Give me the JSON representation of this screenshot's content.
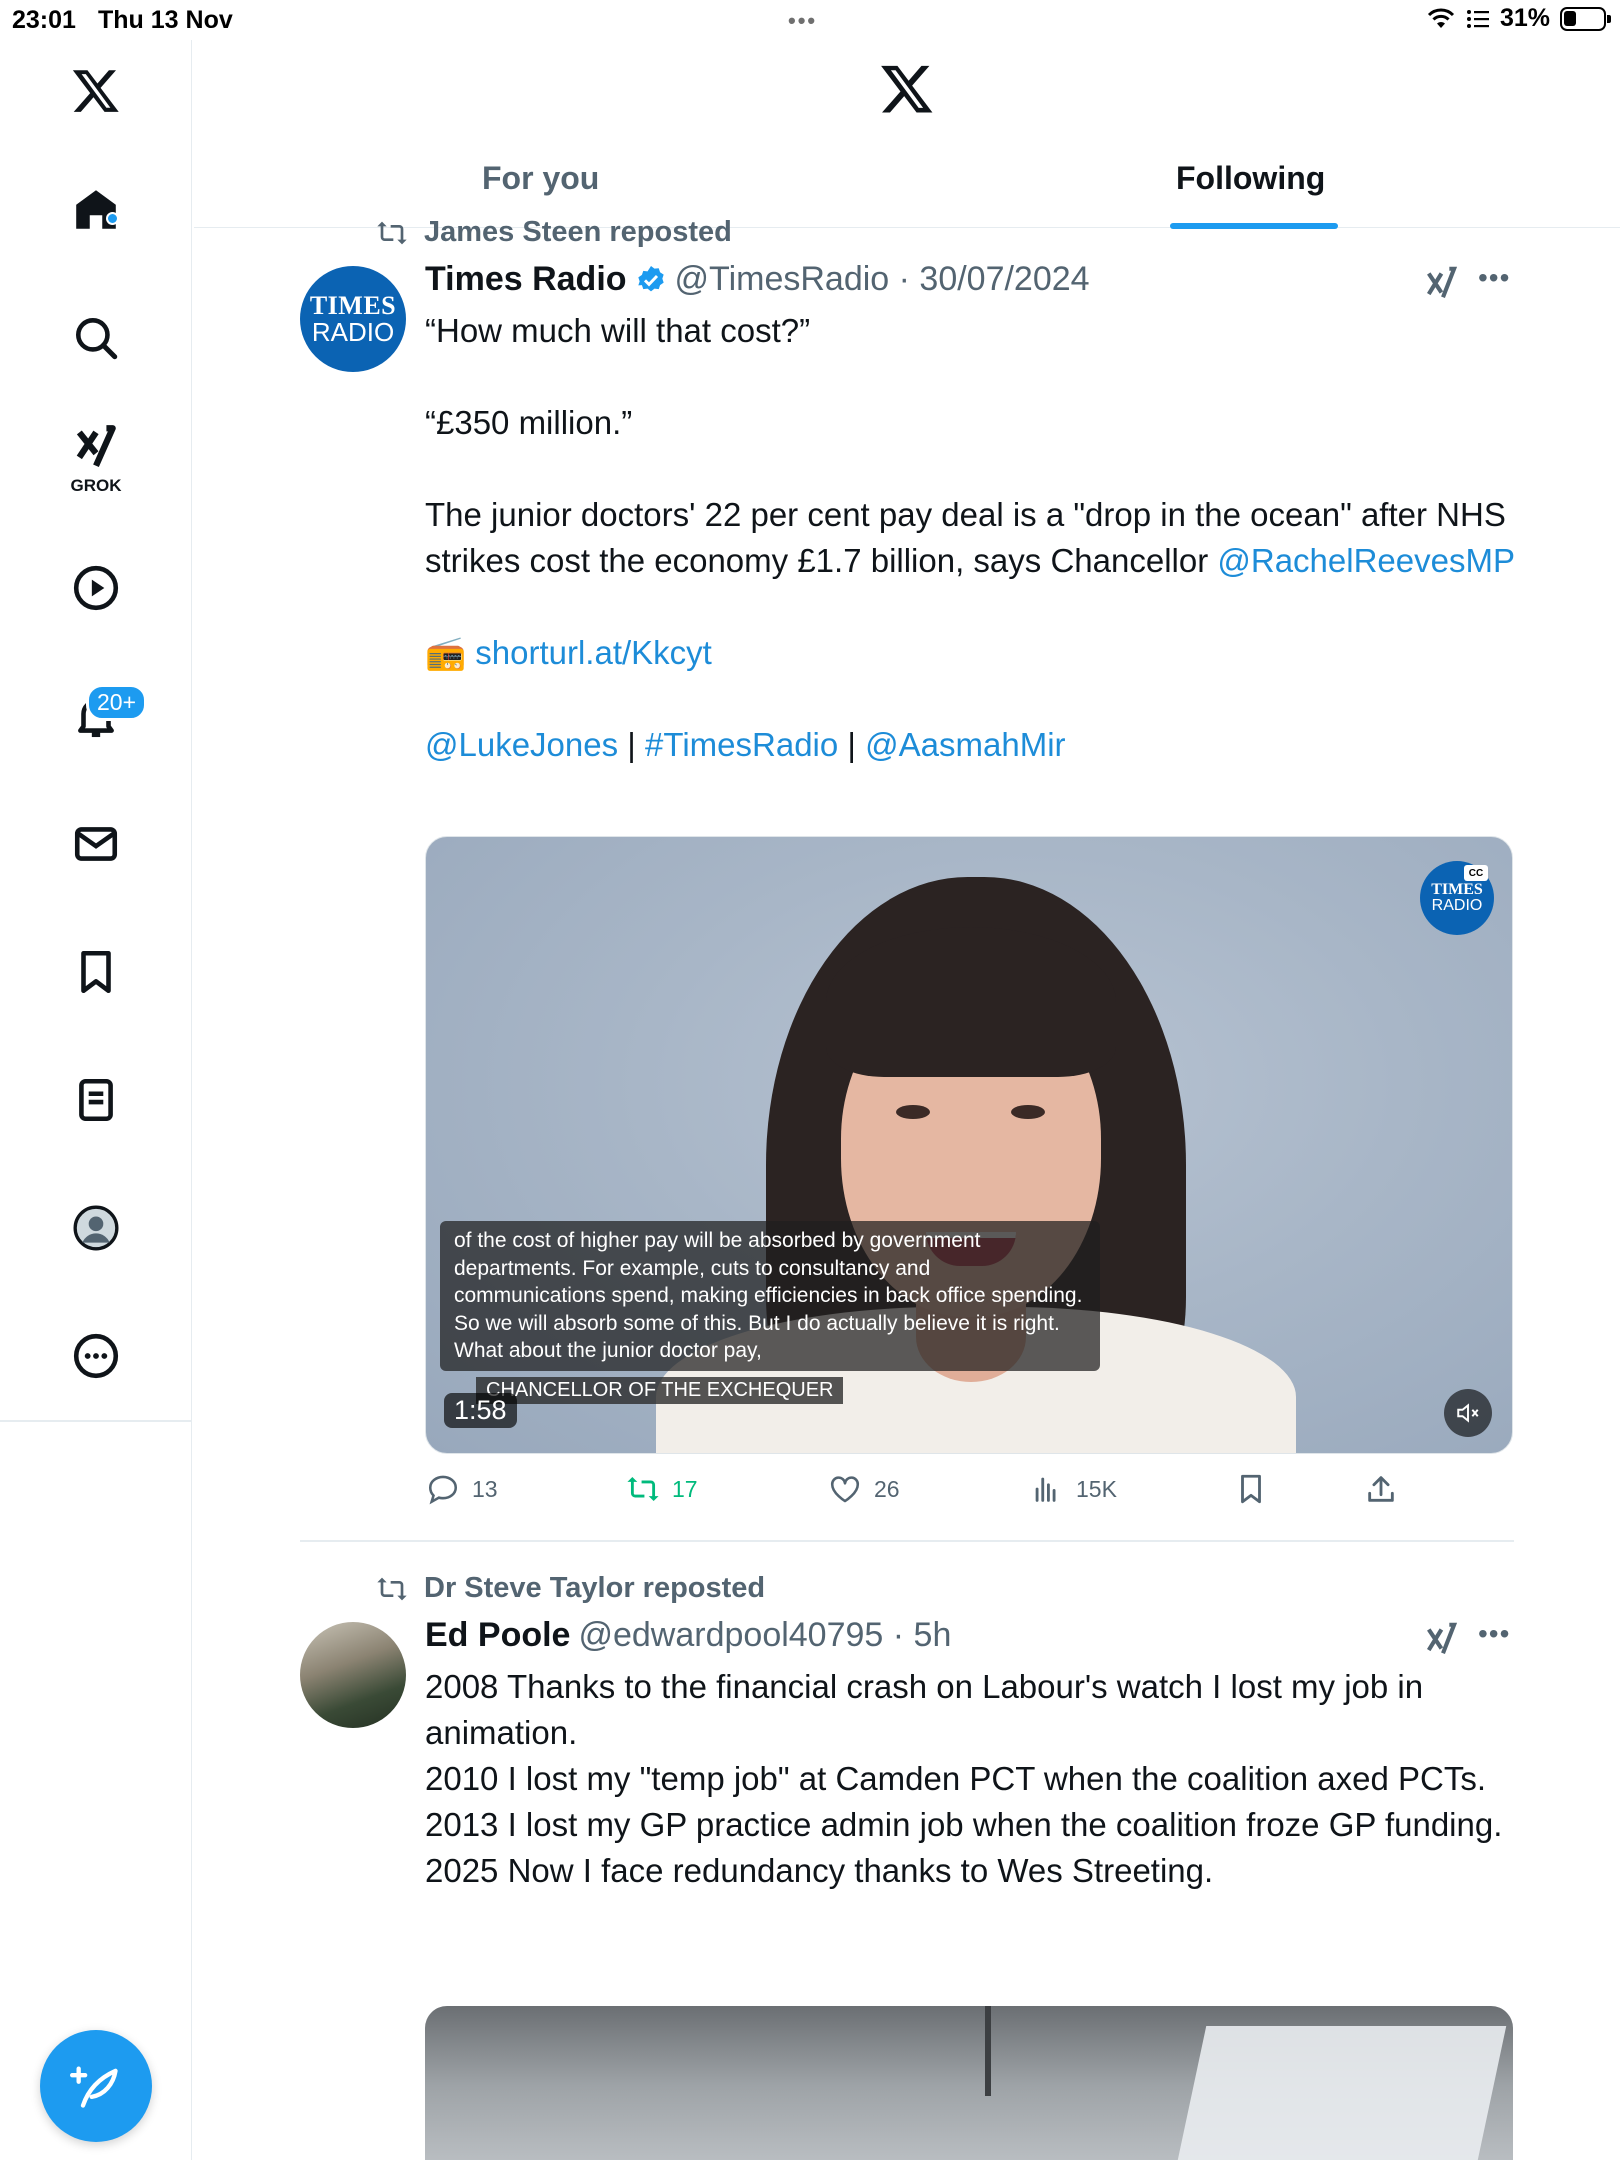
{
  "status_bar": {
    "time": "23:01",
    "date": "Thu 13 Nov",
    "battery": "31%",
    "battery_level": 0.31
  },
  "sidebar": {
    "items": [
      {
        "icon": "x-logo-icon"
      },
      {
        "icon": "home-icon",
        "has_dot": true
      },
      {
        "icon": "search-icon"
      },
      {
        "icon": "grok-icon",
        "label": "GROK"
      },
      {
        "icon": "video-icon"
      },
      {
        "icon": "notifications-icon",
        "badge": "20+"
      },
      {
        "icon": "messages-icon"
      },
      {
        "icon": "bookmarks-icon"
      },
      {
        "icon": "lists-icon"
      },
      {
        "icon": "profile-icon"
      },
      {
        "icon": "more-icon"
      }
    ],
    "compose": {
      "icon": "compose-icon"
    }
  },
  "header": {
    "tabs": [
      {
        "label": "For you",
        "active": false
      },
      {
        "label": "Following",
        "active": true
      }
    ]
  },
  "colors": {
    "accent": "#1d9bf0",
    "link": "#1d8cd8",
    "secondary_text": "#536471",
    "repost_green": "#00ba7c"
  },
  "tweets": [
    {
      "repost_by": "James Steen reposted",
      "avatar": {
        "line1": "TIMES",
        "line2": "RADIO"
      },
      "name": "Times Radio",
      "verified": true,
      "handle_time": "@TimesRadio · 30/07/2024",
      "text": {
        "p1": "“How much will that cost?”",
        "p2": "“£350 million.”",
        "p3": "The junior doctors' 22 per cent pay deal is a \"drop in the ocean\" after NHS strikes cost the economy £1.7 billion, says Chancellor",
        "p3_link": "@RachelReevesMP",
        "radio_emoji": "📻",
        "p4_link": "shorturl.at/Kkcyt",
        "p5_links": [
          "@LukeJones",
          "#TimesRadio",
          "@AasmahMir"
        ],
        "pipe": "|"
      },
      "media": {
        "caption": "of the cost of higher pay will be absorbed by government departments. For example, cuts to consultancy and communications spend, making efficiencies in back office spending. So we will absorb some of this. But I do actually believe it is right. What about the junior doctor pay,",
        "lower_third": "CHANCELLOR OF THE EXCHEQUER",
        "duration": "1:58",
        "corner_logo": {
          "line1": "TIMES",
          "line2": "RADIO"
        },
        "cc": "CC"
      },
      "actions": {
        "replies": "13",
        "reposts": "17",
        "likes": "26",
        "views": "15K"
      }
    },
    {
      "repost_by": "Dr Steve Taylor reposted",
      "name": "Ed Poole",
      "verified": false,
      "handle_time": "@edwardpool40795 · 5h",
      "lines": [
        "2008 Thanks to the financial crash on Labour's watch I lost my job in animation.",
        "2010 I lost my \"temp job\" at Camden PCT when the coalition axed PCTs.",
        "2013 I lost my GP practice admin job when the coalition froze GP funding.",
        "2025 Now I face redundancy thanks to Wes Streeting."
      ]
    }
  ]
}
